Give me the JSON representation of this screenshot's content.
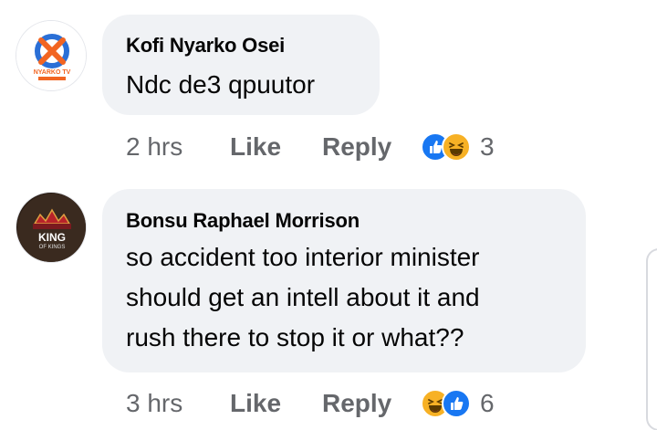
{
  "comments": [
    {
      "author": "Kofi Nyarko Osei",
      "text_lines": [
        "Ndc de3 qpuutor"
      ],
      "time": "2 hrs",
      "like_label": "Like",
      "reply_label": "Reply",
      "reactions": [
        "like",
        "haha"
      ],
      "reaction_count": "3",
      "avatar_text": "NYARKO TV"
    },
    {
      "author": "Bonsu Raphael Morrison",
      "text_lines": [
        "so accident too interior minister",
        "should get an intell about it and",
        "rush there to stop it or what??"
      ],
      "time": "3 hrs",
      "like_label": "Like",
      "reply_label": "Reply",
      "reactions": [
        "haha",
        "like"
      ],
      "reaction_count": "6",
      "avatar_text": "KING OF KINGS"
    }
  ],
  "colors": {
    "bubble": "#f0f2f5",
    "meta": "#65676b",
    "like_blue": "#1877f2",
    "haha_yellow": "#f7b125"
  }
}
